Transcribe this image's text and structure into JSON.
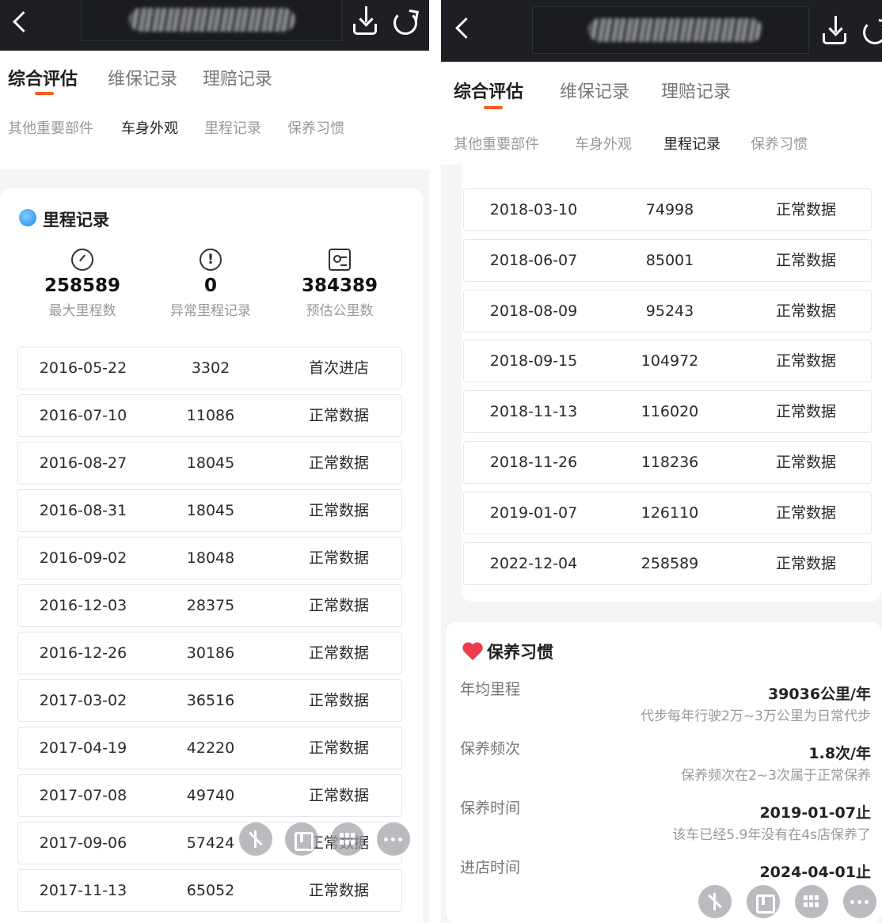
{
  "tabs": [
    "综合评估",
    "维保记录",
    "理赔记录"
  ],
  "subtabs": [
    "其他重要部件",
    "车身外观",
    "里程记录",
    "保养习惯"
  ],
  "mileage": {
    "title": "里程记录",
    "stats": [
      {
        "value": "258589",
        "label": "最大里程数",
        "icon": "speedometer-icon"
      },
      {
        "value": "0",
        "label": "异常里程记录",
        "icon": "alert-icon"
      },
      {
        "value": "384389",
        "label": "预估公里数",
        "icon": "id-card-icon"
      }
    ],
    "rows_left": [
      {
        "date": "2016-05-22",
        "km": "3302",
        "status": "首次进店"
      },
      {
        "date": "2016-07-10",
        "km": "11086",
        "status": "正常数据"
      },
      {
        "date": "2016-08-27",
        "km": "18045",
        "status": "正常数据"
      },
      {
        "date": "2016-08-31",
        "km": "18045",
        "status": "正常数据"
      },
      {
        "date": "2016-09-02",
        "km": "18048",
        "status": "正常数据"
      },
      {
        "date": "2016-12-03",
        "km": "28375",
        "status": "正常数据"
      },
      {
        "date": "2016-12-26",
        "km": "30186",
        "status": "正常数据"
      },
      {
        "date": "2017-03-02",
        "km": "36516",
        "status": "正常数据"
      },
      {
        "date": "2017-04-19",
        "km": "42220",
        "status": "正常数据"
      },
      {
        "date": "2017-07-08",
        "km": "49740",
        "status": "正常数据"
      },
      {
        "date": "2017-09-06",
        "km": "57424",
        "status": "正常数据"
      },
      {
        "date": "2017-11-13",
        "km": "65052",
        "status": "正常数据"
      }
    ],
    "rows_right": [
      {
        "date": "2018-03-10",
        "km": "74998",
        "status": "正常数据"
      },
      {
        "date": "2018-06-07",
        "km": "85001",
        "status": "正常数据"
      },
      {
        "date": "2018-08-09",
        "km": "95243",
        "status": "正常数据"
      },
      {
        "date": "2018-09-15",
        "km": "104972",
        "status": "正常数据"
      },
      {
        "date": "2018-11-13",
        "km": "116020",
        "status": "正常数据"
      },
      {
        "date": "2018-11-26",
        "km": "118236",
        "status": "正常数据"
      },
      {
        "date": "2019-01-07",
        "km": "126110",
        "status": "正常数据"
      },
      {
        "date": "2022-12-04",
        "km": "258589",
        "status": "正常数据"
      }
    ]
  },
  "habits": {
    "title": "保养习惯",
    "items": [
      {
        "label": "年均里程",
        "value": "39036公里/年",
        "note": "代步每年行驶2万~3万公里为日常代步"
      },
      {
        "label": "保养频次",
        "value": "1.8次/年",
        "note": "保养频次在2~3次属于正常保养"
      },
      {
        "label": "保养时间",
        "value": "2019-01-07止",
        "note": "该车已经5.9年没有在4s店保养了"
      },
      {
        "label": "进店时间",
        "value": "2024-04-01止",
        "note": ""
      }
    ]
  },
  "colors": {
    "accent": "#ff5a1f",
    "topbar": "#1d1f24",
    "heart": "#ee3c4b"
  }
}
